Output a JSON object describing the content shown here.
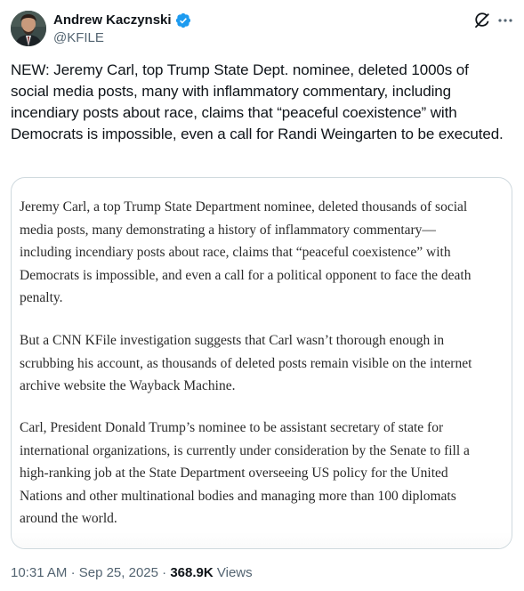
{
  "author": {
    "name": "Andrew Kaczynski",
    "handle": "@KFILE",
    "verified": true,
    "verified_color": "#1d9bf0"
  },
  "header_actions": {
    "grok_icon": "grok-icon",
    "more_icon": "more-icon"
  },
  "tweet": {
    "text": "NEW: Jeremy Carl, top Trump State Dept. nominee, deleted 1000s of social media posts, many with inflammatory commentary, including incendiary posts about race, claims that “peaceful coexistence” with Democrats is impossible, even a call for Randi Weingarten to be executed."
  },
  "article_card": {
    "paragraphs": [
      "Jeremy Carl, a top Trump State Department nominee, deleted thousands of social media posts, many demonstrating a history of inflammatory commentary— including incendiary posts about race, claims that “peaceful coexistence” with Democrats is impossible, and even a call for a political opponent to face the death penalty.",
      "But a CNN KFile investigation suggests that Carl wasn’t thorough enough in scrubbing his account, as thousands of deleted posts remain visible on the internet archive website the Wayback Machine.",
      "Carl, President Donald Trump’s nominee to be assistant secretary of state for international organizations, is currently under consideration by the Senate to fill a high-ranking job at the State Department overseeing US policy for the United Nations and other multinational bodies and managing more than 100 diplomats around the world."
    ]
  },
  "meta": {
    "time": "10:31 AM",
    "separator": "·",
    "date": "Sep 25, 2025",
    "views_count": "368.9K",
    "views_label": "Views"
  }
}
